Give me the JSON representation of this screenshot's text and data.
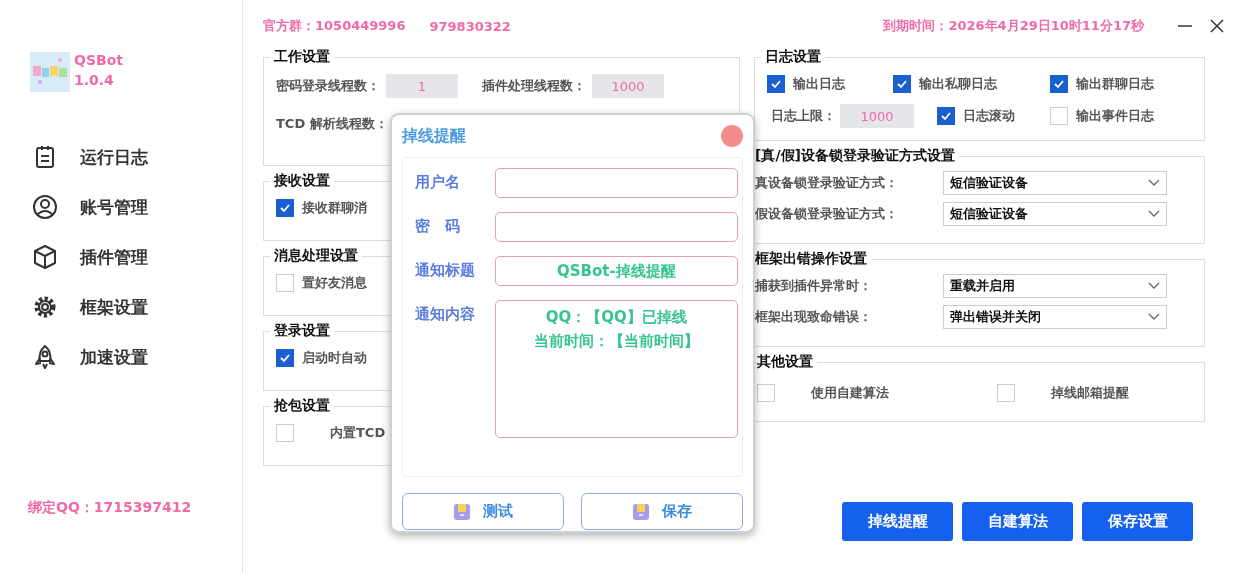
{
  "header": {
    "group_label": "官方群：1050449996",
    "group_number_2": "979830322",
    "expiry": "到期时间：2026年4月29日10时11分17秒"
  },
  "app": {
    "name": "QSBot",
    "version": "1.0.4"
  },
  "sidebar": {
    "items": [
      {
        "label": "运行日志"
      },
      {
        "label": "账号管理"
      },
      {
        "label": "插件管理"
      },
      {
        "label": "框架设置"
      },
      {
        "label": "加速设置"
      }
    ],
    "bound_qq": "绑定QQ：1715397412"
  },
  "work_settings": {
    "title": "工作设置",
    "rows": [
      [
        {
          "label": "密码登录线程数：",
          "value": "1"
        },
        {
          "label": "插件处理线程数：",
          "value": "1000"
        }
      ],
      [
        {
          "label": "TCD 解析线程数："
        }
      ]
    ]
  },
  "left_groups": [
    {
      "title": "接收设置",
      "options": [
        {
          "label": "接收群聊消",
          "checked": true,
          "kind": "plain"
        }
      ]
    },
    {
      "title": "消息处理设置",
      "options": [
        {
          "label": "置好友消息",
          "checked": false,
          "kind": "plain"
        }
      ]
    },
    {
      "title": "登录设置",
      "options": [
        {
          "label": "启动时自动",
          "checked": true,
          "kind": "plain"
        }
      ]
    },
    {
      "title": "抢包设置",
      "options": [
        {
          "label": "内置TCD",
          "checked": false,
          "kind": "spaced"
        }
      ]
    }
  ],
  "log_settings": {
    "title": "日志设置",
    "options": [
      {
        "label": "输出日志",
        "checked": true
      },
      {
        "label": "输出私聊日志",
        "checked": true
      },
      {
        "label": "输出群聊日志",
        "checked": true
      }
    ],
    "limit": {
      "label": "日志上限：",
      "value": "1000"
    },
    "options_2": [
      {
        "label": "日志滚动",
        "checked": true
      },
      {
        "label": "输出事件日志",
        "checked": false
      }
    ]
  },
  "select_groups": [
    {
      "title": "[真/假]设备锁登录验证方式设置",
      "selects": [
        {
          "label": "真设备锁登录验证方式：",
          "value": "短信验证设备"
        },
        {
          "label": "假设备锁登录验证方式：",
          "value": "短信验证设备"
        }
      ]
    },
    {
      "title": "框架出错操作设置",
      "selects": [
        {
          "label": "捕获到插件异常时：",
          "value": "重载并启用"
        },
        {
          "label": "框架出现致命错误：",
          "value": "弹出错误并关闭"
        }
      ]
    }
  ],
  "other_settings": {
    "title": "其他设置",
    "options": [
      {
        "label": "使用自建算法",
        "checked": false,
        "kind": "spaced"
      },
      {
        "label": "掉线邮箱提醒",
        "checked": false,
        "kind": "spaced"
      }
    ]
  },
  "buttons": [
    "掉线提醒",
    "自建算法",
    "保存设置"
  ],
  "dialog": {
    "title": "掉线提醒",
    "fields": [
      {
        "label": "用户名",
        "kind": "input"
      },
      {
        "label": "密　码",
        "kind": "input"
      },
      {
        "label": "通知标题",
        "kind": "input",
        "value": "QSBot-掉线提醒"
      },
      {
        "label": "通知内容",
        "kind": "textarea",
        "lines": [
          "QQ：【QQ】已掉线",
          "当前时间：【当前时间】"
        ]
      }
    ],
    "buttons": [
      "测试",
      "保存"
    ]
  }
}
